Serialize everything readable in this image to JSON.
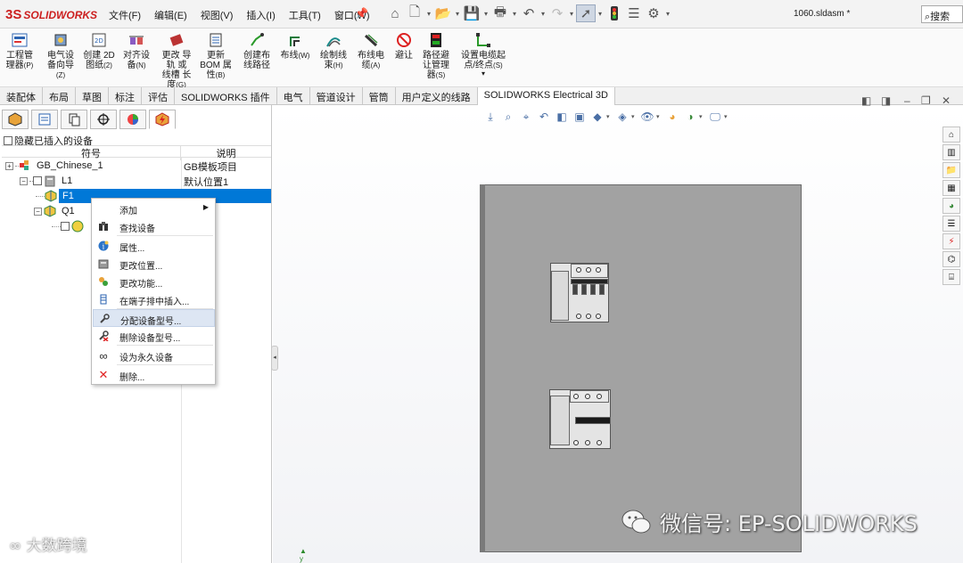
{
  "app": {
    "logo_text": "SOLIDWORKS",
    "logo_prefix": "3S",
    "document_title": "1060.sldasm *",
    "search_label": "搜索"
  },
  "menus": [
    "文件(F)",
    "编辑(E)",
    "视图(V)",
    "插入(I)",
    "工具(T)",
    "窗口(W)"
  ],
  "ribbon": [
    {
      "label": "工程管\n理器",
      "hot": "(P)",
      "icon": "project-manager-icon"
    },
    {
      "label": "电气设\n备向导",
      "hot": "(Z)",
      "icon": "device-wizard-icon"
    },
    {
      "label": "创建 2D\n图纸",
      "hot": "(2)",
      "icon": "create-2d-drawing-icon"
    },
    {
      "label": "对齐设\n备",
      "hot": "(N)",
      "icon": "align-device-icon"
    },
    {
      "label": "更改 导\n轨 或\n线槽 长\n度",
      "hot": "(G)",
      "icon": "change-rail-length-icon"
    },
    {
      "label": "更新\nBOM 属\n性",
      "hot": "(B)",
      "icon": "update-bom-icon"
    },
    {
      "label": "创建布\n线路径",
      "hot": "",
      "icon": "create-route-path-icon"
    },
    {
      "label": "布线",
      "hot": "(W)",
      "icon": "route-wires-icon"
    },
    {
      "label": "绘制线\n束",
      "hot": "(H)",
      "icon": "draw-harness-icon"
    },
    {
      "label": "布线电\n缆",
      "hot": "(A)",
      "icon": "route-cables-icon"
    },
    {
      "label": "避让",
      "hot": "",
      "icon": "avoid-icon"
    },
    {
      "label": "路径避\n让管理\n器",
      "hot": "(S)",
      "icon": "avoidance-manager-icon"
    },
    {
      "label": "设置电缆起\n点/终点",
      "hot": "(S)",
      "icon": "cable-endpoints-icon"
    }
  ],
  "tabs": [
    "装配体",
    "布局",
    "草图",
    "标注",
    "评估",
    "SOLIDWORKS 插件",
    "电气",
    "管道设计",
    "管筒",
    "用户定义的线路",
    "SOLIDWORKS Electrical 3D"
  ],
  "active_tab": "SOLIDWORKS Electrical 3D",
  "left_panel": {
    "hide_inserted_label": "隐藏已插入的设备",
    "col_symbol": "符号",
    "col_desc": "说明",
    "rows": [
      {
        "name": "GB_Chinese_1",
        "desc": "GB模板项目"
      },
      {
        "name": "L1",
        "desc": "默认位置1"
      },
      {
        "name": "F1",
        "desc": ""
      },
      {
        "name": "Q1",
        "desc": ""
      }
    ]
  },
  "context_menu": [
    {
      "label": "添加",
      "icon": "add-icon",
      "submenu": true
    },
    {
      "label": "查找设备",
      "icon": "binoculars-icon"
    },
    {
      "label": "属性...",
      "icon": "info-icon"
    },
    {
      "label": "更改位置...",
      "icon": "location-icon"
    },
    {
      "label": "更改功能...",
      "icon": "function-icon"
    },
    {
      "label": "在端子排中插入...",
      "icon": "terminal-strip-icon"
    },
    {
      "label": "分配设备型号...",
      "icon": "wrench-icon"
    },
    {
      "label": "删除设备型号...",
      "icon": "wrench-delete-icon"
    },
    {
      "label": "设为永久设备",
      "icon": "infinity-icon"
    },
    {
      "label": "删除...",
      "icon": "delete-icon"
    }
  ],
  "watermark": {
    "text": "微信号: EP-SOLIDWORKS",
    "secondary": "大数跨境"
  },
  "colors": {
    "selection": "#0078d7",
    "accent_red": "#cc1f1f",
    "panel_gray": "#a2a2a2"
  }
}
